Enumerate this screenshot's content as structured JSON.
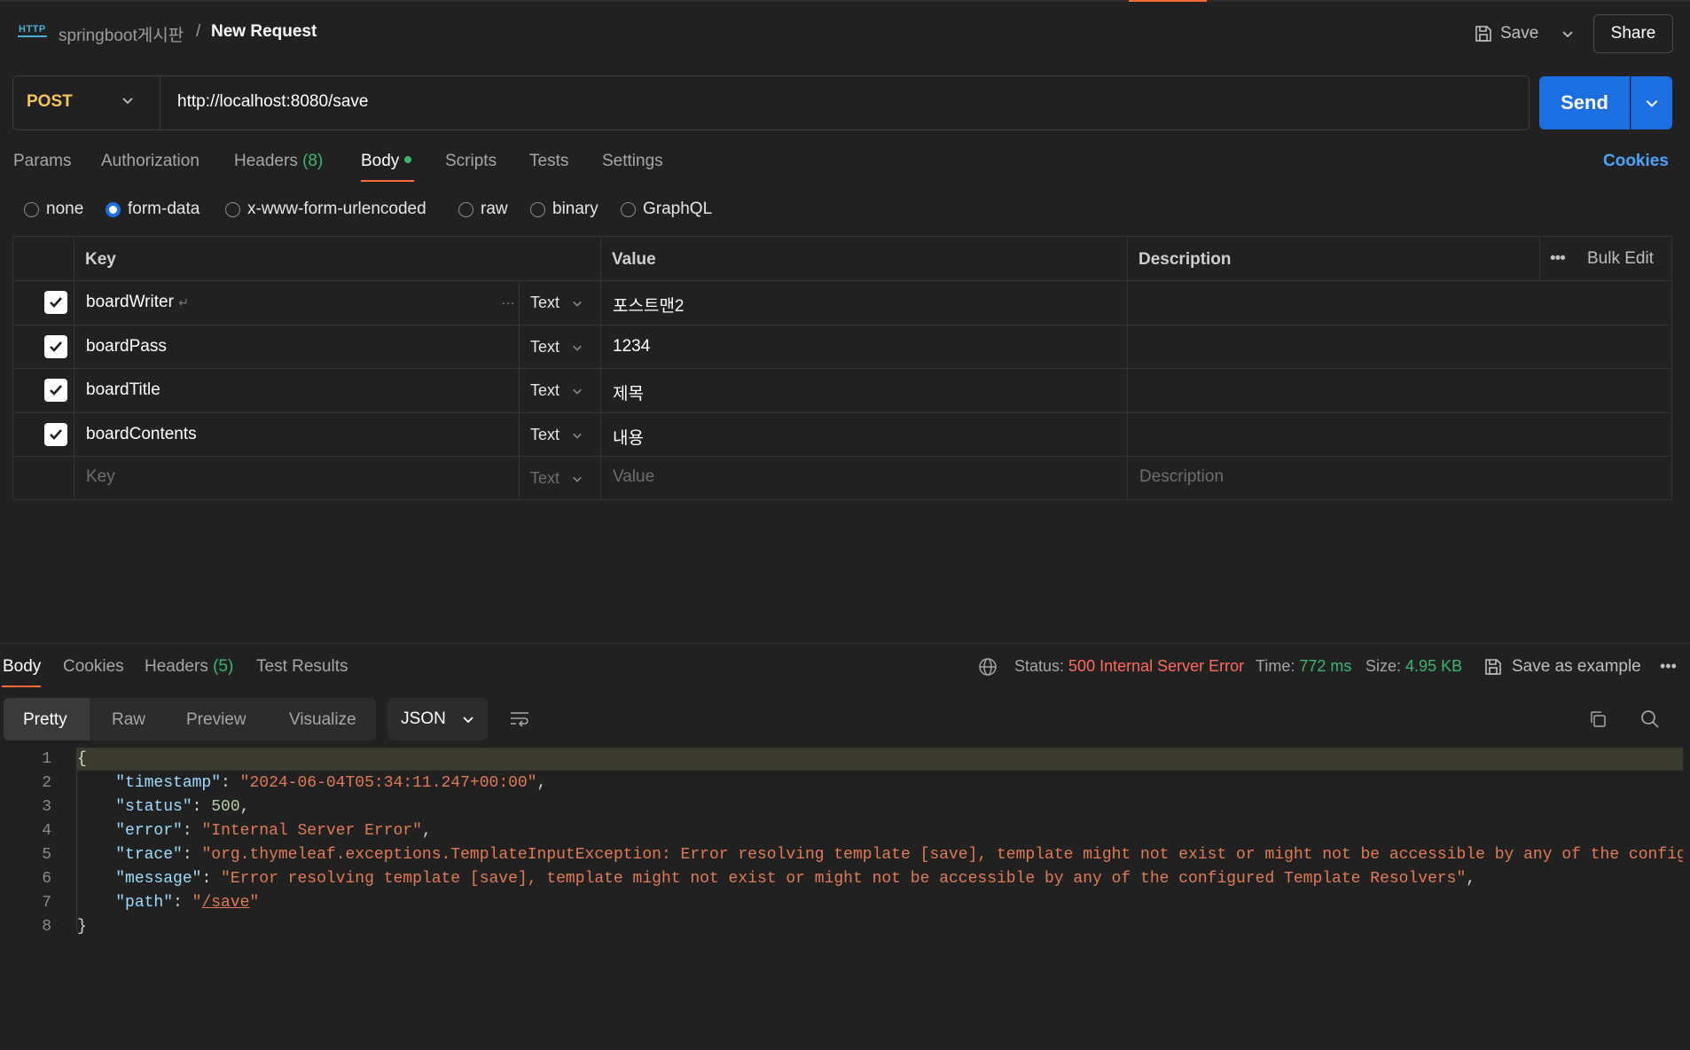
{
  "header": {
    "collection": "springboot게시판",
    "separator": "/",
    "request_name": "New Request",
    "save_label": "Save",
    "share_label": "Share"
  },
  "request": {
    "method": "POST",
    "url": "http://localhost:8080/save",
    "send_label": "Send"
  },
  "request_tabs": {
    "params": "Params",
    "authorization": "Authorization",
    "headers": "Headers",
    "headers_count": "(8)",
    "body": "Body",
    "scripts": "Scripts",
    "tests": "Tests",
    "settings": "Settings",
    "cookies": "Cookies"
  },
  "body_types": {
    "none": "none",
    "form_data": "form-data",
    "urlencoded": "x-www-form-urlencoded",
    "raw": "raw",
    "binary": "binary",
    "graphql": "GraphQL",
    "selected": "form-data"
  },
  "table": {
    "headers": {
      "key": "Key",
      "value": "Value",
      "description": "Description",
      "bulk_edit": "Bulk Edit"
    },
    "rows": [
      {
        "key": "boardWriter",
        "type": "Text",
        "value": "포스트맨2",
        "checked": true
      },
      {
        "key": "boardPass",
        "type": "Text",
        "value": "1234",
        "checked": true
      },
      {
        "key": "boardTitle",
        "type": "Text",
        "value": "제목",
        "checked": true
      },
      {
        "key": "boardContents",
        "type": "Text",
        "value": "내용",
        "checked": true
      }
    ],
    "placeholder": {
      "key": "Key",
      "type": "Text",
      "value": "Value",
      "description": "Description"
    }
  },
  "response": {
    "tabs": {
      "body": "Body",
      "cookies": "Cookies",
      "headers": "Headers",
      "headers_count": "(5)",
      "test_results": "Test Results"
    },
    "status_label": "Status:",
    "status_value": "500 Internal Server Error",
    "time_label": "Time:",
    "time_value": "772 ms",
    "size_label": "Size:",
    "size_value": "4.95 KB",
    "save_example": "Save as example",
    "views": {
      "pretty": "Pretty",
      "raw": "Raw",
      "preview": "Preview",
      "visualize": "Visualize"
    },
    "format": "JSON",
    "json": {
      "timestamp": "2024-06-04T05:34:11.247+00:00",
      "status": 500,
      "error": "Internal Server Error",
      "trace": "org.thymeleaf.exceptions.TemplateInputException: Error resolving template [save], template might not exist or might not be accessible by any of the config",
      "message": "Error resolving template [save], template might not exist or might not be accessible by any of the configured Template Resolvers",
      "path": "/save"
    },
    "line_numbers": [
      "1",
      "2",
      "3",
      "4",
      "5",
      "6",
      "7",
      "8"
    ]
  },
  "colors": {
    "accent": "#ff6c37",
    "send": "#1b6fe0",
    "method": "#f5c45b",
    "success": "#3bb66e",
    "error": "#ff6b5b"
  }
}
